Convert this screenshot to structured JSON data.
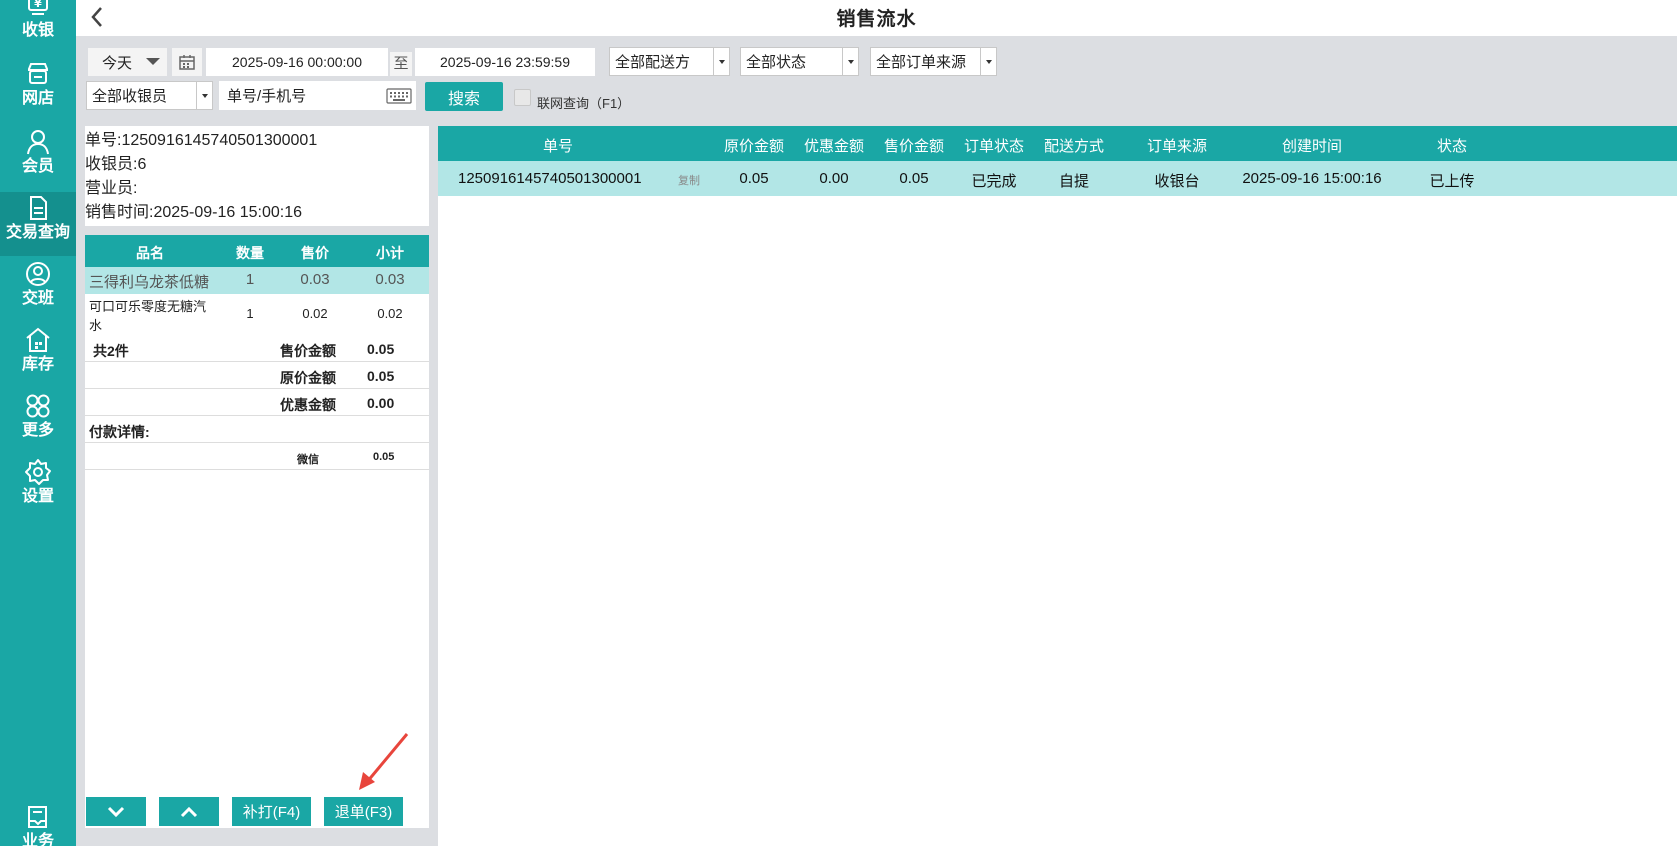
{
  "sidebar": {
    "items": [
      {
        "label": "收银",
        "icon": "cash-register-icon"
      },
      {
        "label": "网店",
        "icon": "store-icon"
      },
      {
        "label": "会员",
        "icon": "member-icon"
      },
      {
        "label": "交易查询",
        "icon": "document-icon",
        "active": true
      },
      {
        "label": "交班",
        "icon": "shift-handover-icon"
      },
      {
        "label": "库存",
        "icon": "warehouse-icon"
      },
      {
        "label": "更多",
        "icon": "grid-more-icon"
      },
      {
        "label": "设置",
        "icon": "gear-icon"
      },
      {
        "label": "业务",
        "icon": "business-book-icon"
      }
    ]
  },
  "header": {
    "title": "销售流水",
    "back_icon": "chevron-left-icon"
  },
  "filters": {
    "period": "今天",
    "start_time": "2025-09-16 00:00:00",
    "separator": "至",
    "end_time": "2025-09-16 23:59:59",
    "delivery": "全部配送方",
    "status": "全部状态",
    "order_source": "全部订单来源",
    "cashier": "全部收银员",
    "search_placeholder": "单号/手机号",
    "search_label": "搜索",
    "online_query_label": "联网查询（F1）"
  },
  "detail": {
    "order_no": "单号:1250916145740501300001",
    "cashier": "收银员:6",
    "salesperson": "营业员:",
    "sale_time": "销售时间:2025-09-16 15:00:16",
    "columns": [
      "品名",
      "数量",
      "售价",
      "小计"
    ],
    "items": [
      {
        "name": "三得利乌龙茶低糖",
        "qty": "1",
        "price": "0.03",
        "subtotal": "0.03"
      },
      {
        "name": "可口可乐零度无糖汽水",
        "qty": "1",
        "price": "0.02",
        "subtotal": "0.02"
      }
    ],
    "total_count": "共2件",
    "summary": [
      {
        "label": "售价金额",
        "value": "0.05"
      },
      {
        "label": "原价金额",
        "value": "0.05"
      },
      {
        "label": "优惠金额",
        "value": "0.00"
      }
    ],
    "payment_title": "付款详情:",
    "payments": [
      {
        "method": "微信",
        "amount": "0.05"
      }
    ],
    "buttons": {
      "down": "chevron-down-icon",
      "up": "chevron-up-icon",
      "reprint": "补打(F4)",
      "refund": "退单(F3)"
    }
  },
  "orders": {
    "columns": [
      "单号",
      "原价金额",
      "优惠金额",
      "售价金额",
      "订单状态",
      "配送方式",
      "订单来源",
      "创建时间",
      "状态"
    ],
    "rows": [
      {
        "order_no": "1250916145740501300001",
        "copy": "复制",
        "original": "0.05",
        "discount": "0.00",
        "sale": "0.05",
        "order_status": "已完成",
        "delivery": "自提",
        "source": "收银台",
        "created": "2025-09-16 15:00:16",
        "status": "已上传"
      }
    ]
  },
  "colors": {
    "accent": "#1aa7a5",
    "selected_row": "#b2e6e6",
    "annotation_arrow": "#e8453c"
  }
}
